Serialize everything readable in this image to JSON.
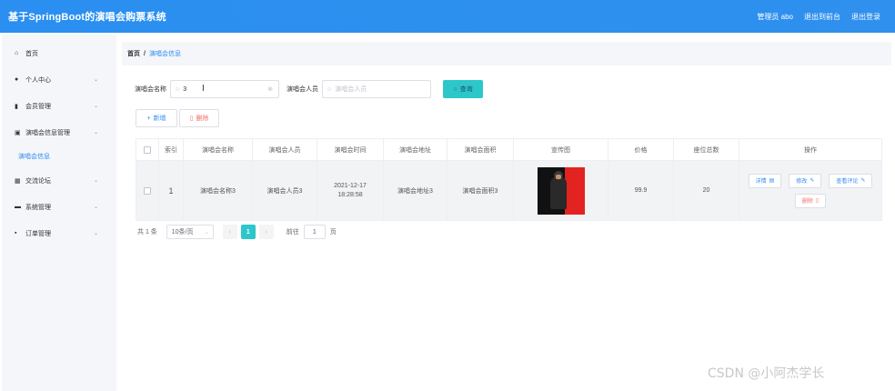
{
  "app": {
    "title": "基于SpringBoot的演唱会购票系统"
  },
  "topbar": {
    "user": "管理员 abo",
    "back_to_front": "退出到前台",
    "logout": "退出登录"
  },
  "sidebar": {
    "items": [
      {
        "icon": "home-icon",
        "glyph": "⌂",
        "label": "首页",
        "chevron": ""
      },
      {
        "icon": "user-icon",
        "glyph": "●",
        "label": "个人中心",
        "chevron": "⌄"
      },
      {
        "icon": "chart-icon",
        "glyph": "▮",
        "label": "会员管理",
        "chevron": "⌄"
      },
      {
        "icon": "bag-icon",
        "glyph": "▣",
        "label": "演唱会信息管理",
        "chevron": "⌄"
      },
      {
        "icon": "grid-icon",
        "glyph": "▦",
        "label": "交流论坛",
        "chevron": "⌄"
      },
      {
        "icon": "system-icon",
        "glyph": "▬",
        "label": "系统管理",
        "chevron": "⌄"
      },
      {
        "icon": "order-icon",
        "glyph": "▪",
        "label": "订单管理",
        "chevron": "⌄"
      }
    ],
    "sub_item": "演唱会信息"
  },
  "breadcrumb": {
    "home": "首页",
    "separator": "/",
    "current": "演唱会信息"
  },
  "search": {
    "name_label": "演唱会名称",
    "name_value": "3",
    "singer_label": "演唱会人员",
    "singer_placeholder": "演唱会人员",
    "query_button": "查询"
  },
  "actions": {
    "add": "新增",
    "delete": "删除"
  },
  "table": {
    "headers": [
      "索引",
      "演唱会名称",
      "演唱会人员",
      "演唱会时间",
      "演唱会地址",
      "演唱会面积",
      "宣传图",
      "价格",
      "座位总数",
      "操作"
    ],
    "rows": [
      {
        "index": "1",
        "name": "演唱会名称3",
        "singer": "演唱会人员3",
        "time": "2021-12-17 18:28:58",
        "address": "演唱会地址3",
        "area": "演唱会面积3",
        "price": "99.9",
        "seats": "20",
        "ops": {
          "detail": "详情",
          "edit": "修改",
          "comments": "查看评论",
          "delete": "删除"
        }
      }
    ]
  },
  "pagination": {
    "total": "共 1 条",
    "page_size": "10条/页",
    "current_page": "1",
    "goto_label": "前往",
    "goto_value": "1",
    "page_unit": "页"
  },
  "watermark": "CSDN @小阿杰学长",
  "colors": {
    "topbar": "#2d8ff0",
    "accent": "#2ec7c9",
    "link": "#2d8cf0",
    "danger": "#f56c6c"
  }
}
